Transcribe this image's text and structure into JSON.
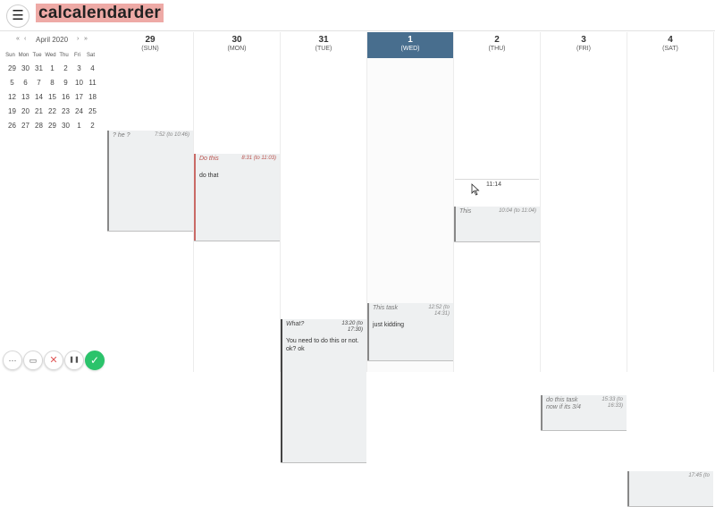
{
  "header": {
    "menu_icon": "hamburger-icon",
    "menu_glyph": "☰",
    "app_name": "calcalendarder",
    "logo_color": "#eeaaa6"
  },
  "mini_calendar": {
    "month_label": "April 2020",
    "prev_year": "«",
    "prev_month": "‹",
    "next_month": "›",
    "next_year": "»",
    "weekdays": [
      "Sun",
      "Mon",
      "Tue",
      "Wed",
      "Thu",
      "Fri",
      "Sat"
    ],
    "weeks": [
      [
        "29",
        "30",
        "31",
        "1",
        "2",
        "3",
        "4"
      ],
      [
        "5",
        "6",
        "7",
        "8",
        "9",
        "10",
        "11"
      ],
      [
        "12",
        "13",
        "14",
        "15",
        "16",
        "17",
        "18"
      ],
      [
        "19",
        "20",
        "21",
        "22",
        "23",
        "24",
        "25"
      ],
      [
        "26",
        "27",
        "28",
        "29",
        "30",
        "1",
        "2"
      ]
    ]
  },
  "days": [
    {
      "num": "29",
      "dow": "(SUN)",
      "today": false
    },
    {
      "num": "30",
      "dow": "(MON)",
      "today": false
    },
    {
      "num": "31",
      "dow": "(TUE)",
      "today": false
    },
    {
      "num": "1",
      "dow": "(WED)",
      "today": true
    },
    {
      "num": "2",
      "dow": "(THU)",
      "today": false
    },
    {
      "num": "3",
      "dow": "(FRI)",
      "today": false
    },
    {
      "num": "4",
      "dow": "(SAT)",
      "today": false
    }
  ],
  "accent": "#486e8e",
  "events": [
    {
      "day": 0,
      "title": "? he ?",
      "time": "7:52 (to 10:46)",
      "body": "",
      "style": "grey"
    },
    {
      "day": 1,
      "title": "Do this",
      "time": "8:31 (to 11:03)",
      "body": "do that",
      "style": "red"
    },
    {
      "day": 4,
      "title": "This",
      "time": "10:04 (to 11:04)",
      "body": "",
      "style": "grey"
    },
    {
      "day": 3,
      "title": "This task",
      "time": "12:52 (to 14:31)",
      "body": "just kidding",
      "style": "grey"
    },
    {
      "day": 2,
      "title": "What?",
      "time": "13:20 (to 17:30)",
      "body": "You need to do this or not. ok? ok",
      "style": "dark"
    },
    {
      "day": 5,
      "title": "do this task now if its 3/4",
      "time": "15:33 (to 16:33)",
      "body": "",
      "style": "grey"
    },
    {
      "day": 6,
      "title": "",
      "time": "17:45 (to",
      "body": "",
      "style": "grey"
    }
  ],
  "now_time": "11:14",
  "toolbar": {
    "more": "⋯",
    "more_icon": "more-dots-icon",
    "video": "▭",
    "video_icon": "video-icon",
    "close": "✕",
    "close_icon": "close-icon",
    "pause": "❚❚",
    "pause_icon": "pause-icon",
    "confirm": "✓",
    "confirm_icon": "check-icon"
  }
}
